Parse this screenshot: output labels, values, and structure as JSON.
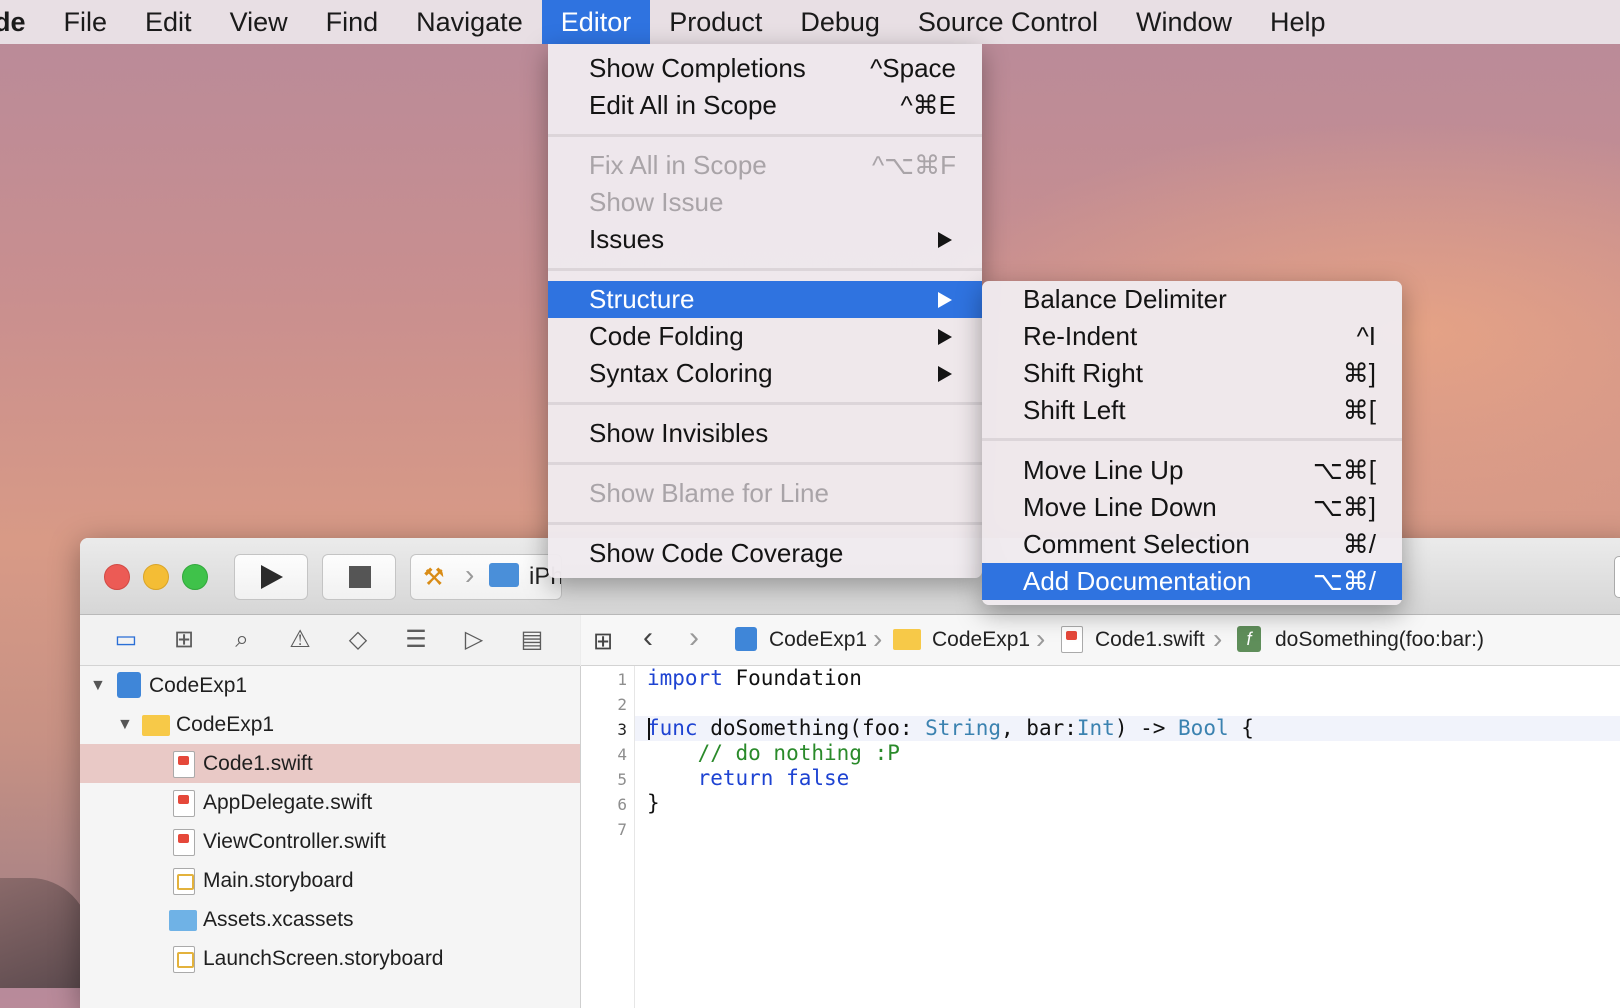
{
  "menubar": {
    "items": [
      "de",
      "File",
      "Edit",
      "View",
      "Find",
      "Navigate",
      "Editor",
      "Product",
      "Debug",
      "Source Control",
      "Window",
      "Help"
    ]
  },
  "editor_menu": {
    "groups": [
      [
        {
          "label": "Show Completions",
          "shortcut": "^Space"
        },
        {
          "label": "Edit All in Scope",
          "shortcut": "^⌘E"
        }
      ],
      [
        {
          "label": "Fix All in Scope",
          "shortcut": "^⌥⌘F"
        },
        {
          "label": "Show Issue",
          "shortcut": ""
        },
        {
          "label": "Issues",
          "shortcut": ""
        }
      ],
      [
        {
          "label": "Structure",
          "shortcut": ""
        },
        {
          "label": "Code Folding",
          "shortcut": ""
        },
        {
          "label": "Syntax Coloring",
          "shortcut": ""
        }
      ],
      [
        {
          "label": "Show Invisibles",
          "shortcut": ""
        }
      ],
      [
        {
          "label": "Show Blame for Line",
          "shortcut": ""
        }
      ],
      [
        {
          "label": "Show Code Coverage",
          "shortcut": ""
        }
      ]
    ]
  },
  "structure_menu": {
    "items": [
      {
        "label": "Balance Delimiter",
        "shortcut": ""
      },
      {
        "label": "Re-Indent",
        "shortcut": "^I"
      },
      {
        "label": "Shift Right",
        "shortcut": "⌘]"
      },
      {
        "label": "Shift Left",
        "shortcut": "⌘["
      },
      {
        "label": "Move Line Up",
        "shortcut": "⌥⌘["
      },
      {
        "label": "Move Line Down",
        "shortcut": "⌥⌘]"
      },
      {
        "label": "Comment Selection",
        "shortcut": "⌘/"
      },
      {
        "label": "Add Documentation",
        "shortcut": "⌥⌘/"
      }
    ]
  },
  "toolbar": {
    "scheme_label": "iPh"
  },
  "jumpbar": {
    "crumbs": [
      "CodeExp1",
      "CodeExp1",
      "Code1.swift",
      "doSomething(foo:bar:)"
    ]
  },
  "navigator": {
    "rows": [
      "CodeExp1",
      "CodeExp1",
      "Code1.swift",
      "AppDelegate.swift",
      "ViewController.swift",
      "Main.storyboard",
      "Assets.xcassets",
      "LaunchScreen.storyboard"
    ]
  },
  "code": {
    "line_numbers": [
      "1",
      "2",
      "3",
      "4",
      "5",
      "6",
      "7"
    ],
    "l1_kw": "import",
    "l1_rest": " Foundation",
    "l3_kw": "func",
    "l3_a": " doSomething(foo: ",
    "l3_t1": "String",
    "l3_b": ", bar:",
    "l3_t2": "Int",
    "l3_c": ") -> ",
    "l3_t3": "Bool",
    "l3_d": " {",
    "l4": "    // do nothing :P",
    "l5_kw1": "return",
    "l5_kw2": "false",
    "l6": "}"
  },
  "colors": {
    "accent": "#2f73e0",
    "selection_row": "#e9c9c6",
    "keyword": "#1e43d2",
    "type": "#3b82b0",
    "comment": "#2a8a2a"
  }
}
